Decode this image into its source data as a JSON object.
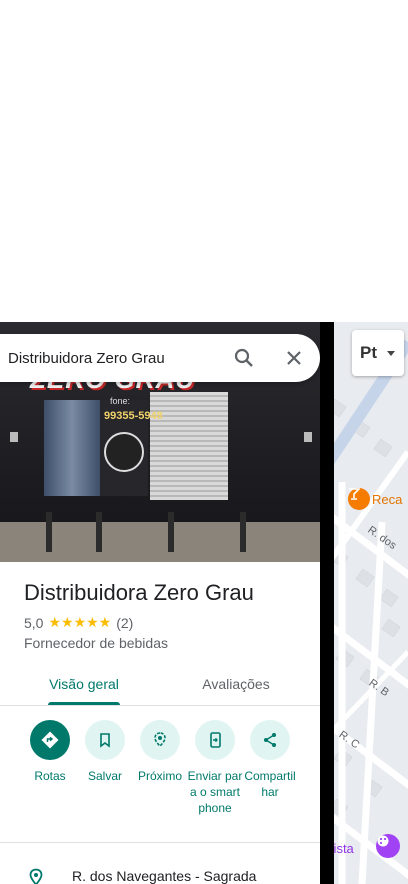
{
  "search": {
    "query": "Distribuidora Zero Grau",
    "search_icon": "search-icon",
    "close_icon": "close-icon"
  },
  "photo": {
    "sign_text": "ZERO GRAU",
    "fone_label": "fone:",
    "phone_text": "99355-5948"
  },
  "place": {
    "name": "Distribuidora Zero Grau",
    "rating": "5,0",
    "stars": "★★★★★",
    "review_count": "(2)",
    "category": "Fornecedor de bebidas"
  },
  "tabs": [
    {
      "label": "Visão geral",
      "active": true
    },
    {
      "label": "Avaliações",
      "active": false
    }
  ],
  "actions": [
    {
      "label": "Rotas",
      "icon": "directions-icon"
    },
    {
      "label": "Salvar",
      "icon": "bookmark-icon"
    },
    {
      "label": "Próximo",
      "icon": "nearby-icon"
    },
    {
      "label": "Enviar para o smartphone",
      "icon": "send-to-phone-icon"
    },
    {
      "label": "Compartilhar",
      "icon": "share-icon"
    }
  ],
  "address": {
    "text": "R. dos Navegantes - Sagrada",
    "icon": "location-pin-icon"
  },
  "map": {
    "language_button": "Pt",
    "street_labels": [
      "R. dos",
      "R. B",
      "R. C"
    ],
    "poi_1": "Reca",
    "poi_2": "rttista"
  },
  "colors": {
    "accent": "#00796b",
    "accent_light": "#e0f5f1",
    "star": "#fbbc04",
    "map_bg": "#e8ebef",
    "road": "#ffffff",
    "road_blue": "#c6d4ea"
  }
}
